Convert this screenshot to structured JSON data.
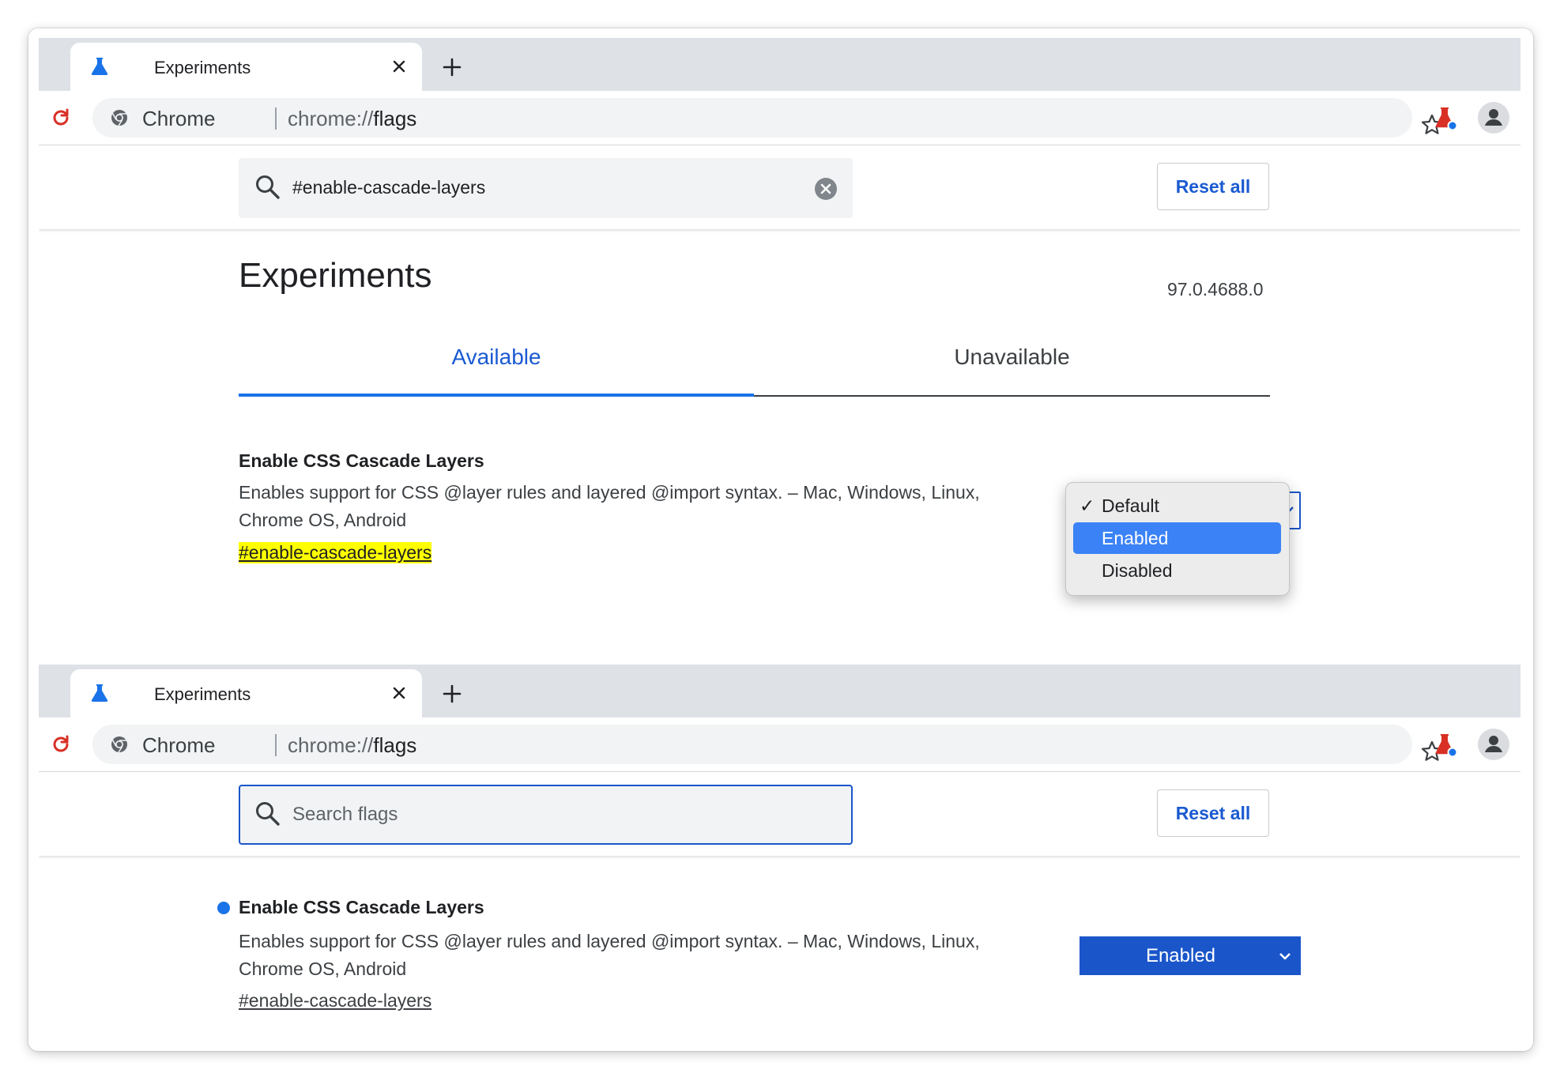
{
  "windows": [
    {
      "tab": {
        "title": "Experiments"
      },
      "omnibox": {
        "site": "Chrome",
        "url_scheme": "chrome://",
        "url_host": "flags"
      },
      "search": {
        "value": "#enable-cascade-layers",
        "placeholder": ""
      },
      "reset_label": "Reset all",
      "page": {
        "title": "Experiments",
        "version": "97.0.4688.0",
        "tabs": [
          "Available",
          "Unavailable"
        ],
        "active_tab": "Available"
      },
      "experiment": {
        "title": "Enable CSS Cascade Layers",
        "description_line1": "Enables support for CSS @layer rules and layered @import syntax. – Mac, Windows, Linux,",
        "description_line2": "Chrome OS, Android",
        "link": "#enable-cascade-layers"
      },
      "dropdown": {
        "options": [
          {
            "label": "Default",
            "checked": true,
            "highlighted": false
          },
          {
            "label": "Enabled",
            "checked": false,
            "highlighted": true
          },
          {
            "label": "Disabled",
            "checked": false,
            "highlighted": false
          }
        ],
        "check_glyph": "✓"
      }
    },
    {
      "tab": {
        "title": "Experiments"
      },
      "omnibox": {
        "site": "Chrome",
        "url_scheme": "chrome://",
        "url_host": "flags"
      },
      "search": {
        "value": "",
        "placeholder": "Search flags"
      },
      "reset_label": "Reset all",
      "experiment": {
        "title": "Enable CSS Cascade Layers",
        "description_line1": "Enables support for CSS @layer rules and layered @import syntax. – Mac, Windows, Linux,",
        "description_line2": "Chrome OS, Android",
        "link": "#enable-cascade-layers",
        "modified": true
      },
      "select": {
        "value": "Enabled"
      }
    }
  ],
  "icons": {
    "tab": "flask-icon",
    "close": "close-icon",
    "new_tab": "plus-icon",
    "reload": "reload-icon",
    "site_info": "chrome-logo-icon",
    "bookmark": "star-icon",
    "extension": "flask-extension-icon",
    "profile": "avatar-icon",
    "search": "search-icon",
    "clear": "clear-icon",
    "chevron": "chevron-down-icon"
  },
  "colors": {
    "accent": "#1a73e8",
    "link_blue": "#1a5ad1",
    "select_blue": "#1a56c9",
    "highlight_yellow": "#ffff00",
    "reload_red": "#d93025",
    "tabstrip": "#dee1e6"
  }
}
